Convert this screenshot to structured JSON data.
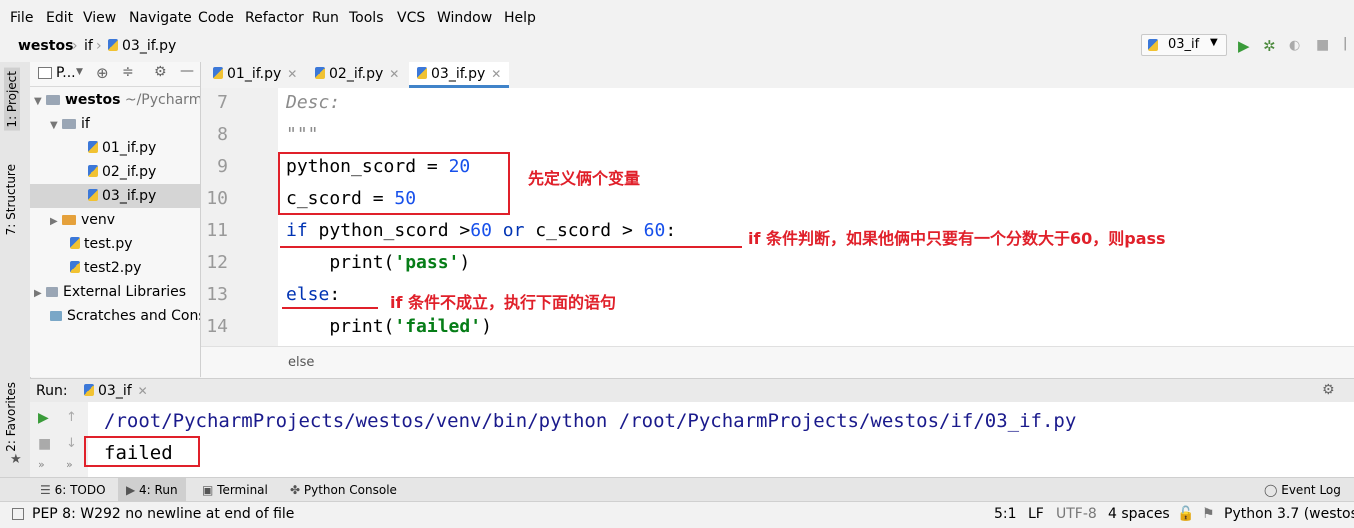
{
  "menu": [
    "File",
    "Edit",
    "View",
    "Navigate",
    "Code",
    "Refactor",
    "Run",
    "Tools",
    "VCS",
    "Window",
    "Help"
  ],
  "breadcrumb": {
    "project": "westos",
    "folder": "if",
    "file": "03_if.py"
  },
  "run_config": "03_if",
  "left_strip": {
    "project": "1: Project",
    "structure": "7: Structure",
    "favorites": "2: Favorites"
  },
  "project_panel": {
    "header": "P...",
    "root": "westos",
    "root_path": "~/PycharmP",
    "folder_if": "if",
    "files": [
      "01_if.py",
      "02_if.py",
      "03_if.py"
    ],
    "venv": "venv",
    "test": "test.py",
    "test2": "test2.py",
    "external": "External Libraries",
    "scratches": "Scratches and Consc"
  },
  "tabs": [
    "01_if.py",
    "02_if.py",
    "03_if.py"
  ],
  "code": {
    "line_numbers": [
      "7",
      "8",
      "9",
      "10",
      "11",
      "12",
      "13",
      "14"
    ],
    "l7": "Desc:",
    "l8": "\"\"\"",
    "l9_a": "python_scord = ",
    "l9_b": "20",
    "l10_a": "c_scord = ",
    "l10_b": "50",
    "l11_kw": "if",
    "l11_a": " python_scord >",
    "l11_n1": "60",
    "l11_or": " or",
    "l11_b": " c_scord > ",
    "l11_n2": "60",
    "l11_c": ":",
    "l12_a": "    print(",
    "l12_s": "'pass'",
    "l12_b": ")",
    "l13_kw": "else",
    "l13_a": ":",
    "l14_a": "    print(",
    "l14_s": "'failed'",
    "l14_b": ")"
  },
  "hint": "else",
  "annotations": {
    "a1": "先定义俩个变量",
    "a2": "if 条件判断，如果他俩中只要有一个分数大于60，则pass",
    "a3": "if 条件不成立，执行下面的语句"
  },
  "run": {
    "label": "Run:",
    "tab": "03_if",
    "cmd": "/root/PycharmProjects/westos/venv/bin/python /root/PycharmProjects/westos/if/03_if.py",
    "output": "failed"
  },
  "bottom_tabs": {
    "todo": "6: TODO",
    "run": "4: Run",
    "terminal": "Terminal",
    "console": "Python Console",
    "eventlog": "Event Log"
  },
  "status": {
    "msg": "PEP 8: W292 no newline at end of file",
    "pos": "5:1",
    "lf": "LF",
    "enc": "UTF-8",
    "indent": "4 spaces",
    "interp": "Python 3.7 (westos"
  },
  "colors": {
    "annotation": "#e0202a",
    "keyword": "#0033b3",
    "number": "#1750eb",
    "string": "#067d17",
    "accent": "#4083c9"
  }
}
